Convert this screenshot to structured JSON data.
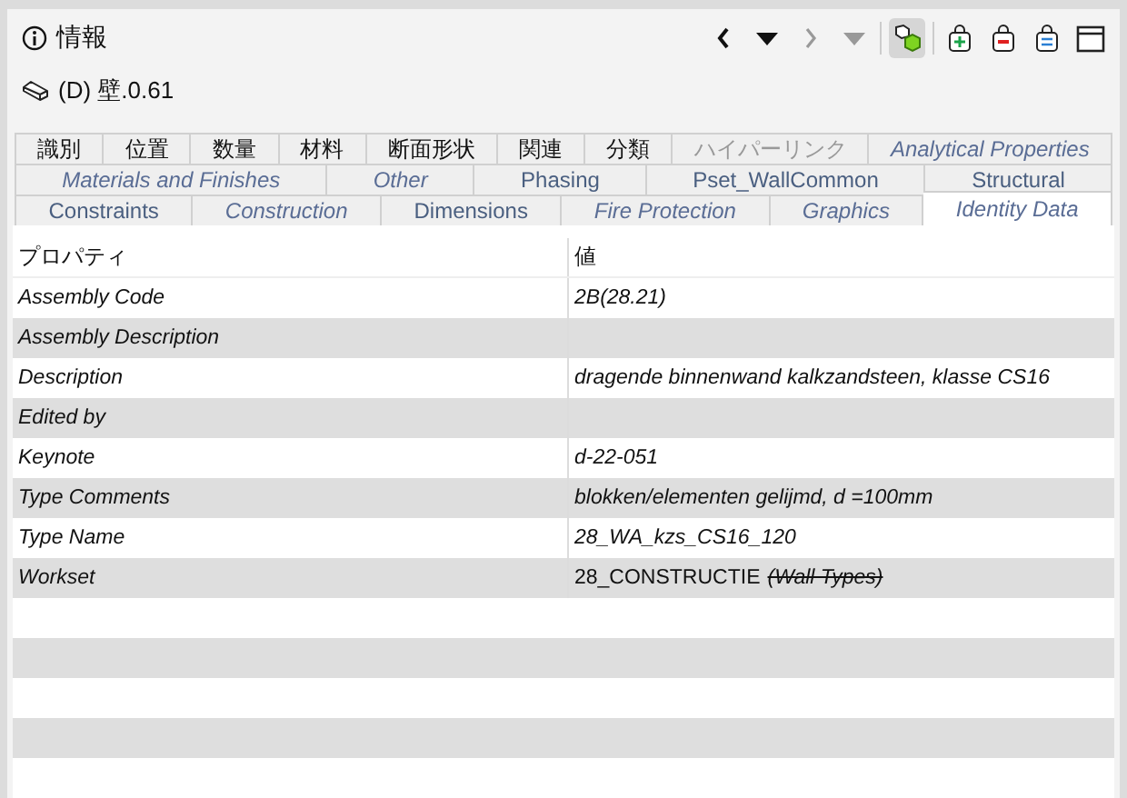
{
  "panel": {
    "title": "情報"
  },
  "toolbar": [
    {
      "kind": "back",
      "disabled": false
    },
    {
      "kind": "history",
      "disabled": false
    },
    {
      "kind": "forward",
      "disabled": true
    },
    {
      "kind": "history",
      "disabled": true
    },
    {
      "kind": "cubes",
      "selected": true
    },
    {
      "kind": "add"
    },
    {
      "kind": "remove"
    },
    {
      "kind": "list"
    },
    {
      "kind": "window"
    }
  ],
  "object": {
    "name": "(D) 壁.0.61"
  },
  "tab_rows": [
    [
      {
        "label": "識別",
        "kind": "plain",
        "selected": false
      },
      {
        "label": "位置",
        "kind": "plain",
        "selected": false
      },
      {
        "label": "数量",
        "kind": "plain",
        "selected": false
      },
      {
        "label": "材料",
        "kind": "plain",
        "selected": false
      },
      {
        "label": "断面形状",
        "kind": "plain",
        "selected": false
      },
      {
        "label": "関連",
        "kind": "plain",
        "selected": false
      },
      {
        "label": "分類",
        "kind": "plain",
        "selected": false
      },
      {
        "label": "ハイパーリンク",
        "kind": "greyed",
        "selected": false
      },
      {
        "label": "Analytical Properties",
        "kind": "italic",
        "selected": false
      }
    ],
    [
      {
        "label": "Materials and Finishes",
        "kind": "italic",
        "selected": false
      },
      {
        "label": "Other",
        "kind": "italic",
        "selected": false
      },
      {
        "label": "Phasing",
        "kind": "blue",
        "selected": false
      },
      {
        "label": "Pset_WallCommon",
        "kind": "blue",
        "selected": false
      },
      {
        "label": "Structural",
        "kind": "blue",
        "selected": false
      }
    ],
    [
      {
        "label": "Constraints",
        "kind": "blue",
        "selected": false
      },
      {
        "label": "Construction",
        "kind": "italic",
        "selected": false
      },
      {
        "label": "Dimensions",
        "kind": "blue",
        "selected": false
      },
      {
        "label": "Fire Protection",
        "kind": "italic",
        "selected": false
      },
      {
        "label": "Graphics",
        "kind": "italic",
        "selected": false
      },
      {
        "label": "Identity Data",
        "kind": "italic",
        "selected": true
      }
    ]
  ],
  "table": {
    "columns": [
      "プロパティ",
      "値"
    ],
    "rows": [
      {
        "name": "Assembly Code",
        "value": "2B(28.21)"
      },
      {
        "name": "Assembly Description"
      },
      {
        "name": "Description",
        "value": "dragende binnenwand kalkzandsteen, klasse CS16"
      },
      {
        "name": "Edited by"
      },
      {
        "name": "Keynote",
        "value": "d-22-051"
      },
      {
        "name": "Type Comments",
        "value": "blokken/elementen gelijmd, d =100mm"
      },
      {
        "name": "Type Name",
        "value": "28_WA_kzs_CS16_120"
      },
      {
        "name": "Workset",
        "value": "28_CONSTRUCTIE",
        "struck_note": "(Wall Types)"
      }
    ]
  }
}
